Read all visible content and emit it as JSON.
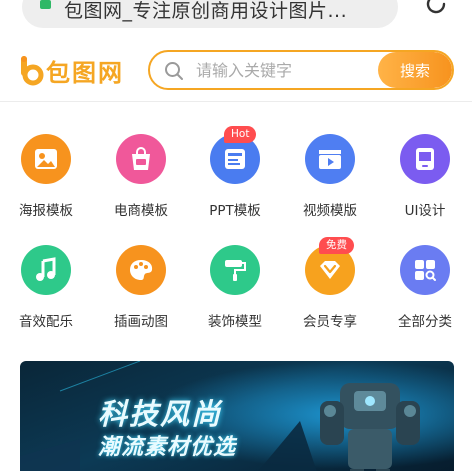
{
  "browser": {
    "url_text": "包图网_专注原创商用设计图片..."
  },
  "header": {
    "logo_text": "包图网",
    "search_placeholder": "请输入关键字",
    "search_button": "搜索",
    "accent_color": "#f5a623"
  },
  "categories": [
    {
      "label": "海报模板",
      "icon": "poster-image-icon",
      "color": "#f7931e"
    },
    {
      "label": "电商模板",
      "icon": "shopping-bag-icon",
      "color": "#f0589a"
    },
    {
      "label": "PPT模板",
      "icon": "ppt-icon",
      "color": "#4a7cf0",
      "tag": "Hot"
    },
    {
      "label": "视频模版",
      "icon": "video-clapper-icon",
      "color": "#4f7ef2"
    },
    {
      "label": "UI设计",
      "icon": "tablet-icon",
      "color": "#7b5cf0"
    },
    {
      "label": "音效配乐",
      "icon": "music-note-icon",
      "color": "#2ec98a"
    },
    {
      "label": "插画动图",
      "icon": "palette-icon",
      "color": "#f7931e"
    },
    {
      "label": "装饰模型",
      "icon": "paint-roller-icon",
      "color": "#2ec98a"
    },
    {
      "label": "会员专享",
      "icon": "vip-diamond-icon",
      "color": "#f7a21e",
      "tag": "免费"
    },
    {
      "label": "全部分类",
      "icon": "all-categories-icon",
      "color": "#6a7cf2"
    }
  ],
  "banner": {
    "title": "科技风尚",
    "subtitle": "潮流素材优选"
  }
}
